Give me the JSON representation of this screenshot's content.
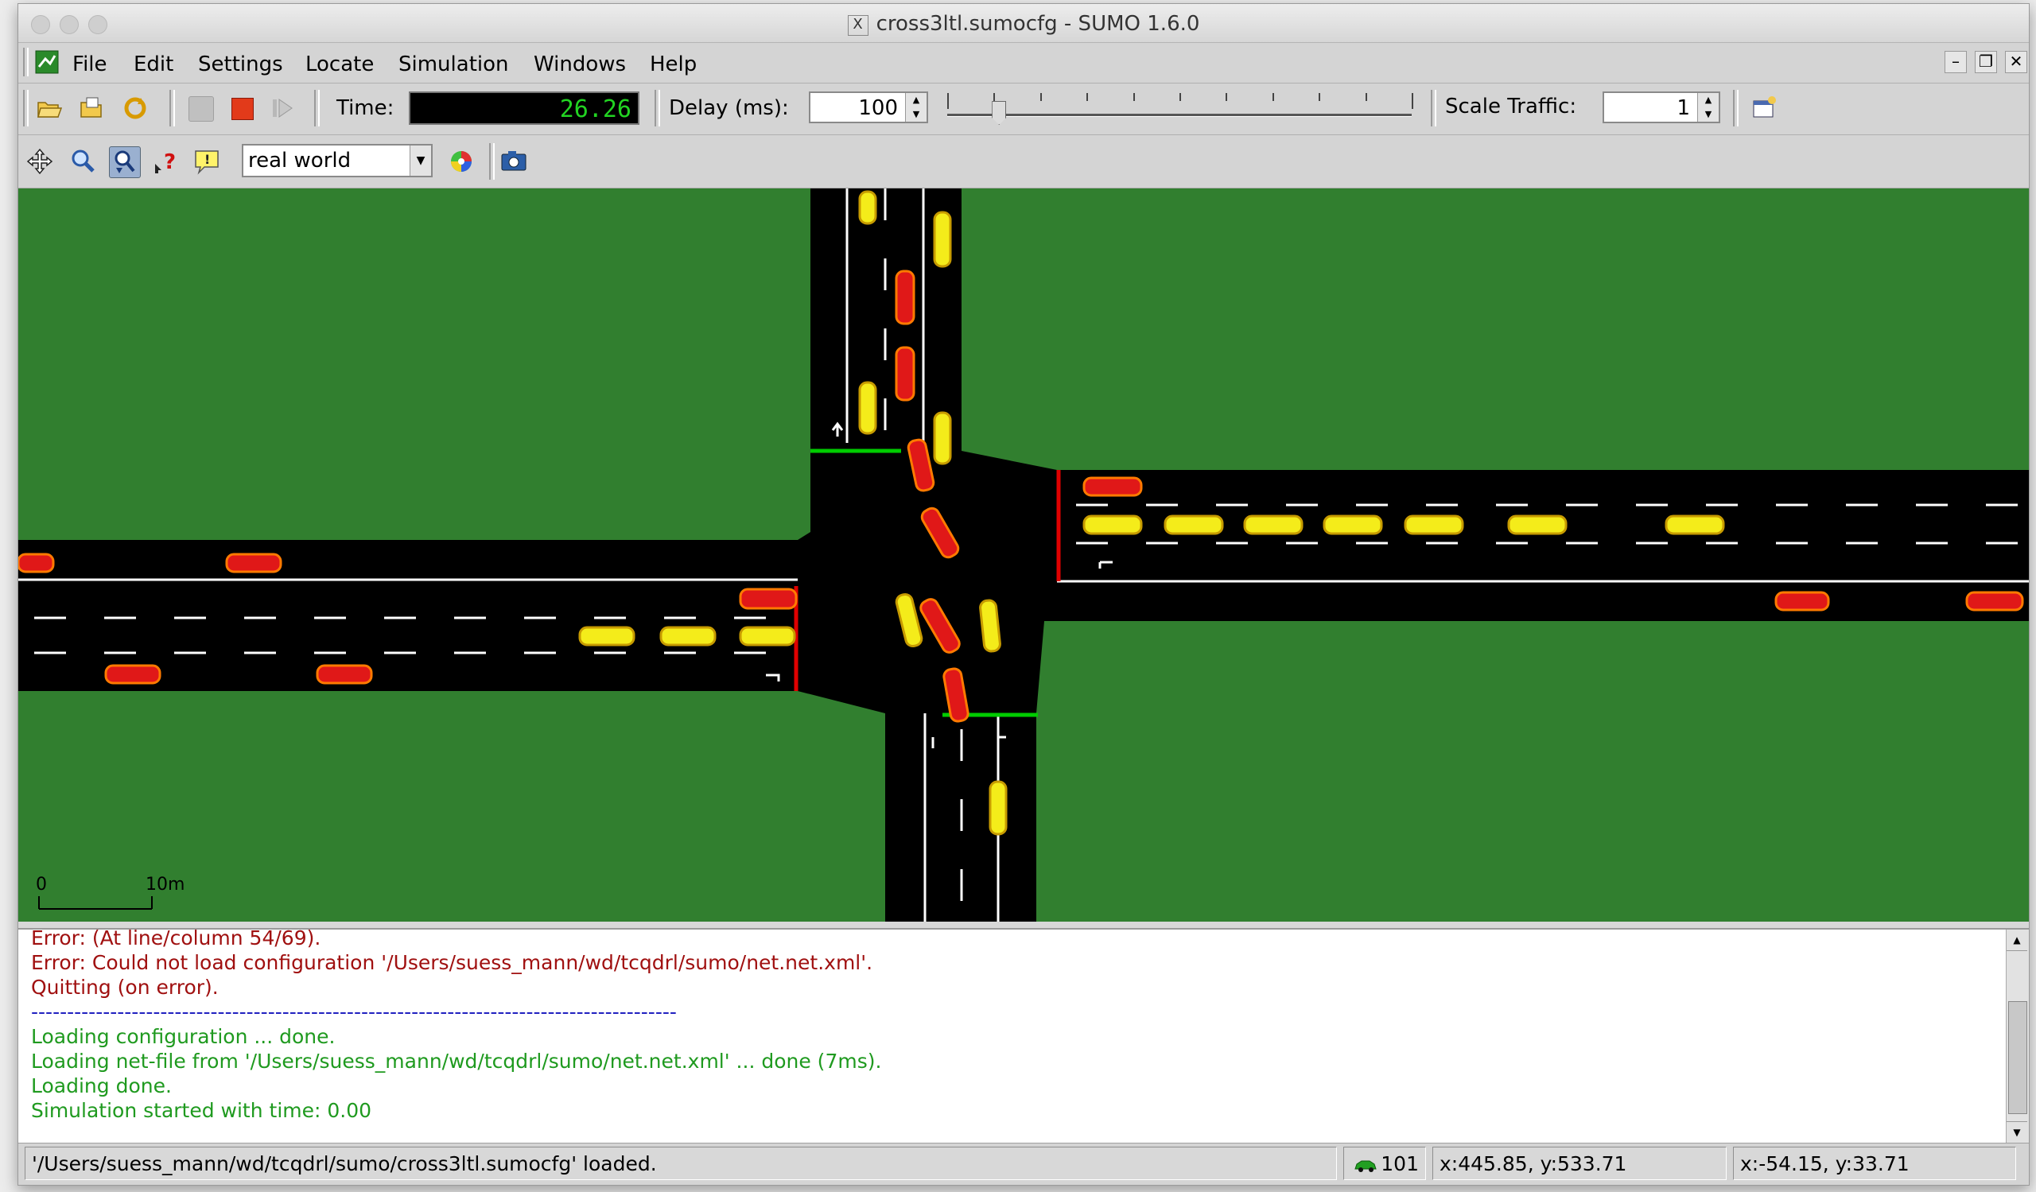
{
  "window": {
    "title": "cross3ltl.sumocfg - SUMO 1.6.0",
    "title_icon": "X"
  },
  "menu": [
    "File",
    "Edit",
    "Settings",
    "Locate",
    "Simulation",
    "Windows",
    "Help"
  ],
  "toolbar": {
    "time_label": "Time:",
    "time_value": "26.26",
    "delay_label": "Delay (ms):",
    "delay_value": "100",
    "delay_slider_fraction": 0.11,
    "scale_label": "Scale Traffic:",
    "scale_value": "1"
  },
  "view_toolbar": {
    "scheme_value": "real world"
  },
  "scale_bar": {
    "zero": "0",
    "ten": "10m"
  },
  "log": {
    "lines": [
      {
        "text": "Error:  (At line/column 54/69).",
        "kind": "error"
      },
      {
        "text": "Error: Could not load configuration '/Users/suess_mann/wd/tcqdrl/sumo/net.net.xml'.",
        "kind": "error"
      },
      {
        "text": "Quitting (on error).",
        "kind": "error"
      },
      {
        "text": "------------------------------------------------------------------------------------------",
        "kind": "separator"
      },
      {
        "text": "Loading configuration ... done.",
        "kind": "ok"
      },
      {
        "text": "Loading net-file from '/Users/suess_mann/wd/tcqdrl/sumo/net.net.xml' ... done (7ms).",
        "kind": "ok"
      },
      {
        "text": "Loading done.",
        "kind": "ok"
      },
      {
        "text": "Simulation started with time: 0.00",
        "kind": "ok"
      }
    ]
  },
  "status": {
    "message": "'/Users/suess_mann/wd/tcqdrl/sumo/cross3ltl.sumocfg' loaded.",
    "vehicle_count": "101",
    "coords_net": "x:445.85, y:533.71",
    "coords_geo": "x:-54.15, y:33.71"
  },
  "colors": {
    "grass": "#317f2f",
    "road": "#000000",
    "car_yellow": "#f4ec1a",
    "car_red": "#e01818",
    "signal_red": "#e00000",
    "signal_green": "#00cc00",
    "log_error": "#a01010",
    "log_ok": "#1f9a1f",
    "log_separator": "#2020c0"
  },
  "icons": [
    "app-icon",
    "open-icon",
    "reload-config-icon",
    "reload-icon",
    "run-icon",
    "stop-icon",
    "step-icon",
    "recenter-icon",
    "zoom-icon",
    "locate-icon",
    "query-icon",
    "tooltip-icon",
    "color-wheel-icon",
    "camera-icon",
    "car-icon"
  ]
}
